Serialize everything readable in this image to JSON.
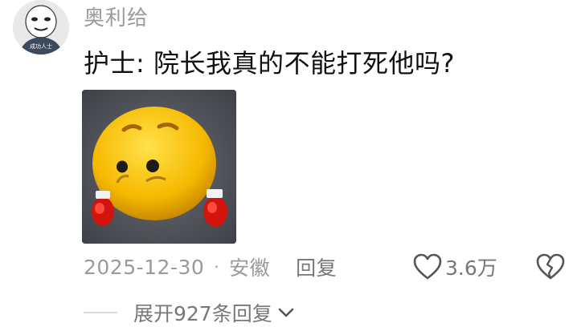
{
  "comment": {
    "avatar": {
      "caption": "成功人士"
    },
    "username": "奥利给",
    "text": "护士: 院长我真的不能打死他吗?",
    "image": {
      "description_icon": "crying-emoji-boxing-gloves-icon"
    },
    "date": "2025-12-30",
    "separator": "·",
    "location": "安徽",
    "reply_label": "回复",
    "likes": "3.6万"
  },
  "expand_replies": {
    "label": "展开927条回复"
  },
  "icons": {
    "like": "heart-outline-icon",
    "dislike": "broken-heart-icon",
    "expand": "chevron-down-icon"
  },
  "colors": {
    "username": "#9a9a9a",
    "text": "#111111",
    "meta": "#9a9a9a",
    "action": "#777777"
  }
}
